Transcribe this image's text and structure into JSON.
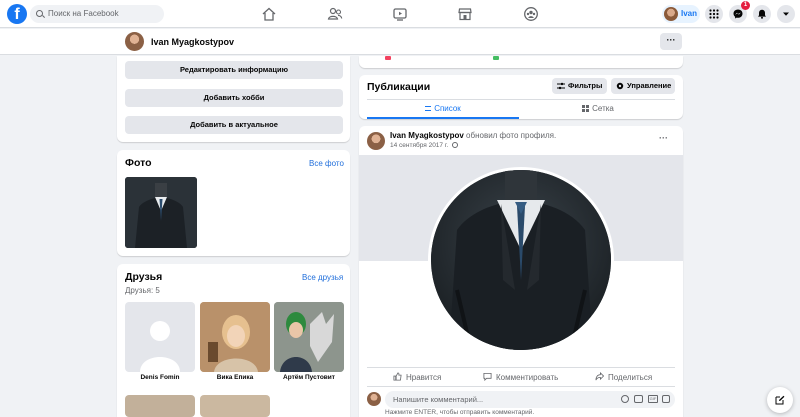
{
  "topbar": {
    "logo": "f",
    "search_placeholder": "Поиск на Facebook",
    "user_name": "Ivan",
    "notification_count": "1",
    "icons": [
      "home-icon",
      "friends-icon",
      "watch-icon",
      "marketplace-icon",
      "groups-icon",
      "menu-grid-icon",
      "messenger-icon",
      "bell-icon",
      "account-caret-icon"
    ]
  },
  "subbar": {
    "name": "Ivan Myagkostypov",
    "more": "···"
  },
  "intro": {
    "buttons": [
      "Редактировать информацию",
      "Добавить хобби",
      "Добавить в актуальное"
    ]
  },
  "photos": {
    "title": "Фото",
    "all_link": "Все фото"
  },
  "friends": {
    "title": "Друзья",
    "count": "Друзья: 5",
    "all_link": "Все друзья",
    "items": [
      {
        "name": "Denis Fomin"
      },
      {
        "name": "Вика Епика"
      },
      {
        "name": "Артём Пустовит"
      }
    ]
  },
  "posts": {
    "title": "Публикации",
    "filters_label": "Фильтры",
    "manage_label": "Управление",
    "tab_list": "Список",
    "tab_grid": "Сетка"
  },
  "post": {
    "author": "Ivan Myagkostypov",
    "action": "обновил фото профиля.",
    "date": "14 сентября 2017 г.",
    "more": "···",
    "like": "Нравится",
    "comment": "Комментировать",
    "share": "Поделиться",
    "comment_placeholder": "Напишите комментарий...",
    "enter_hint": "Нажмите ENTER, чтобы отправить комментарий."
  },
  "colors": {
    "accent": "#1877f2",
    "link": "#216fdb",
    "background": "#f0f2f5"
  }
}
